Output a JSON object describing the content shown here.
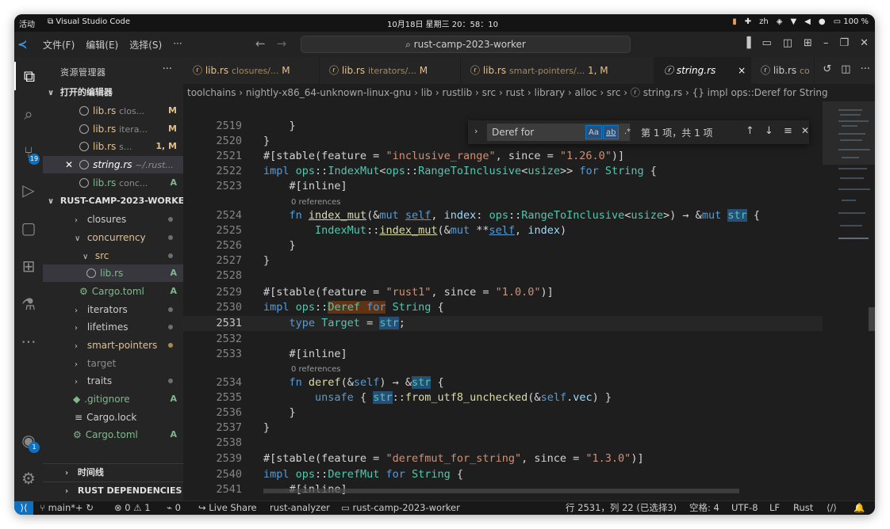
{
  "system_bar": {
    "activities": "活动",
    "app_name": "Visual Studio Code",
    "clock": "10月18日 星期三 20：58：10",
    "locale": "zh",
    "battery": "100 %"
  },
  "titlebar": {
    "menus": [
      "文件(F)",
      "编辑(E)",
      "选择(S)",
      "···"
    ],
    "search_text": "rust-camp-2023-worker"
  },
  "activity_bar": {
    "scm_badge": "19",
    "account_badge": "1"
  },
  "sidebar": {
    "header": "资源管理器",
    "more": "···",
    "open_editors_title": "打开的编辑器",
    "open_editors": [
      {
        "name": "lib.rs",
        "dir": "clos...",
        "status": "M"
      },
      {
        "name": "lib.rs",
        "dir": "itera...",
        "status": "M"
      },
      {
        "name": "lib.rs",
        "dir": "s...",
        "status": "1, M"
      },
      {
        "name": "string.rs",
        "dir": "~/.rust...",
        "status": ""
      },
      {
        "name": "lib.rs",
        "dir": "conc...",
        "status": "A"
      }
    ],
    "project_title": "RUST-CAMP-2023-WORKER",
    "tree": [
      {
        "name": "closures",
        "status": "dot"
      },
      {
        "name": "concurrency",
        "status": "dot"
      },
      {
        "name": "src",
        "status": "dot"
      },
      {
        "name": "lib.rs",
        "status": "A"
      },
      {
        "name": "Cargo.toml",
        "status": "A"
      },
      {
        "name": "iterators",
        "status": "dot"
      },
      {
        "name": "lifetimes",
        "status": "dot"
      },
      {
        "name": "smart-pointers",
        "status": "dot"
      },
      {
        "name": "target",
        "status": ""
      },
      {
        "name": "traits",
        "status": "dot"
      },
      {
        "name": ".gitignore",
        "status": "A"
      },
      {
        "name": "Cargo.lock",
        "status": ""
      },
      {
        "name": "Cargo.toml",
        "status": "A"
      }
    ],
    "timeline_title": "时间线",
    "deps_title": "RUST DEPENDENCIES"
  },
  "tabs": [
    {
      "name": "lib.rs",
      "dir": "closures/...",
      "status": "M"
    },
    {
      "name": "lib.rs",
      "dir": "iterators/...",
      "status": "M"
    },
    {
      "name": "lib.rs",
      "dir": "smart-pointers/...",
      "status": "1, M"
    },
    {
      "name": "string.rs",
      "dir": "",
      "status": "×"
    },
    {
      "name": "lib.rs",
      "dir": "co",
      "status": ""
    }
  ],
  "breadcrumb": "toolchains › nightly-x86_64-unknown-linux-gnu › lib › rustlib › src › rust › library › alloc › src › ⓡ string.rs › {} impl ops::Deref for String",
  "find_widget": {
    "query": "Deref for",
    "opt_case": "Aa",
    "opt_word": "ab",
    "opt_regex": ".*",
    "result_count": "第 1 项，共 1 项"
  },
  "editor": {
    "references_label": "0 references",
    "line_numbers": [
      "2519",
      "2520",
      "2521",
      "2522",
      "2523",
      "2524",
      "2525",
      "2526",
      "2527",
      "2528",
      "2529",
      "2530",
      "2531",
      "2532",
      "2533",
      "2534",
      "2535",
      "2536",
      "2537",
      "2538",
      "2539",
      "2540",
      "2541"
    ],
    "current_line": "2531"
  },
  "status_bar": {
    "branch": "main*+",
    "problems": "⊗ 0 ⚠ 1",
    "ports": "0",
    "live_share": "Live Share",
    "analyzer": "rust-analyzer",
    "workspace": "rust-camp-2023-worker",
    "cursor": "行 2531，列 22 (已选择3)",
    "indent": "空格: 4",
    "encoding": "UTF-8",
    "eol": "LF",
    "language": "Rust"
  }
}
